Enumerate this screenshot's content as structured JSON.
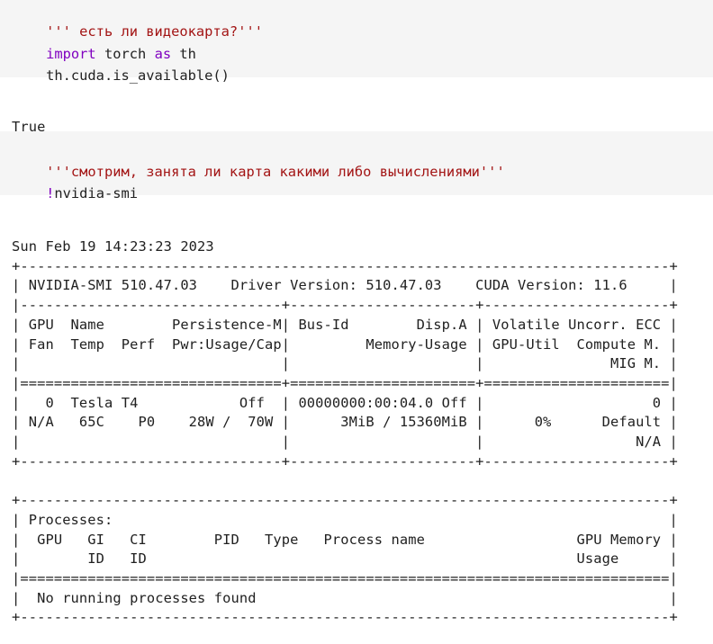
{
  "cells": [
    {
      "input_lines": [
        [
          {
            "t": "str",
            "v": "''' есть ли видеокарта?'''"
          }
        ],
        [
          {
            "t": "kw",
            "v": "import"
          },
          {
            "t": "plain",
            "v": " torch "
          },
          {
            "t": "kw",
            "v": "as"
          },
          {
            "t": "plain",
            "v": " th"
          }
        ],
        [
          {
            "t": "plain",
            "v": "th.cuda.is_available()"
          }
        ]
      ],
      "output": "True"
    },
    {
      "input_lines": [
        [
          {
            "t": "str",
            "v": "'''смотрим, занята ли карта какими либо вычислениями'''"
          }
        ],
        [
          {
            "t": "bang",
            "v": "!"
          },
          {
            "t": "plain",
            "v": "nvidia-smi"
          }
        ]
      ],
      "output": "Sun Feb 19 14:23:23 2023       \n+-----------------------------------------------------------------------------+\n| NVIDIA-SMI 510.47.03    Driver Version: 510.47.03    CUDA Version: 11.6     |\n|-------------------------------+----------------------+----------------------+\n| GPU  Name        Persistence-M| Bus-Id        Disp.A | Volatile Uncorr. ECC |\n| Fan  Temp  Perf  Pwr:Usage/Cap|         Memory-Usage | GPU-Util  Compute M. |\n|                               |                      |               MIG M. |\n|===============================+======================+======================|\n|   0  Tesla T4            Off  | 00000000:00:04.0 Off |                    0 |\n| N/A   65C    P0    28W /  70W |      3MiB / 15360MiB |      0%      Default |\n|                               |                      |                  N/A |\n+-------------------------------+----------------------+----------------------+\n                                                                               \n+-----------------------------------------------------------------------------+\n| Processes:                                                                  |\n|  GPU   GI   CI        PID   Type   Process name                  GPU Memory |\n|        ID   ID                                                   Usage      |\n|=============================================================================|\n|  No running processes found                                                 |\n+-----------------------------------------------------------------------------+"
    }
  ]
}
